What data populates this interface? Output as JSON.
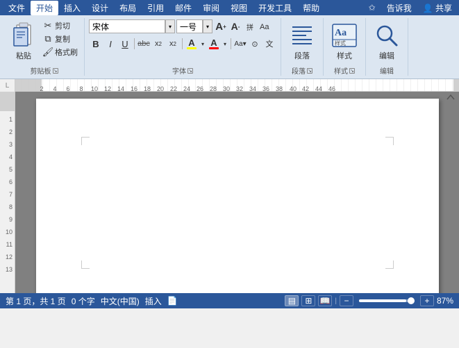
{
  "menu": {
    "items": [
      "文件",
      "开始",
      "插入",
      "设计",
      "布局",
      "引用",
      "邮件",
      "审阅",
      "视图",
      "开发工具",
      "帮助"
    ],
    "right_items": [
      "✩",
      "告诉我",
      "👤 共享"
    ],
    "active": "开始"
  },
  "ribbon": {
    "clipboard_group": {
      "label": "剪贴板",
      "paste_label": "粘贴",
      "cut_label": "剪切",
      "copy_label": "复制",
      "format_paint_label": "格式刷"
    },
    "font_group": {
      "label": "字体",
      "font_name": "宋体",
      "font_size": "一号",
      "bold": "B",
      "italic": "I",
      "underline": "U",
      "strikethrough": "abc",
      "subscript": "x₂",
      "superscript": "x²",
      "highlight": "A",
      "font_color": "A",
      "font_size_up": "A↑",
      "font_size_down": "A↓",
      "clear_format": "Aa",
      "phonetic": "文",
      "circle": "字"
    },
    "para_group": {
      "label": "段落",
      "icon": "≡"
    },
    "styles_group": {
      "label": "样式",
      "icon": "Aa"
    },
    "edit_group": {
      "label": "编辑",
      "icon": "🔍"
    }
  },
  "ruler": {
    "unit": "L",
    "marks": [
      "2",
      "4",
      "6",
      "8",
      "10",
      "12",
      "14",
      "16",
      "18",
      "20",
      "22",
      "24",
      "26",
      "28",
      "30",
      "32",
      "34",
      "36",
      "38",
      "40",
      "42",
      "44",
      "46"
    ]
  },
  "document": {
    "content": ""
  },
  "status_bar": {
    "page": "第 1 页，共 1 页",
    "words": "0 个字",
    "language": "中文(中国)",
    "mode": "插入",
    "macro_icon": "📄",
    "zoom": "87%"
  }
}
